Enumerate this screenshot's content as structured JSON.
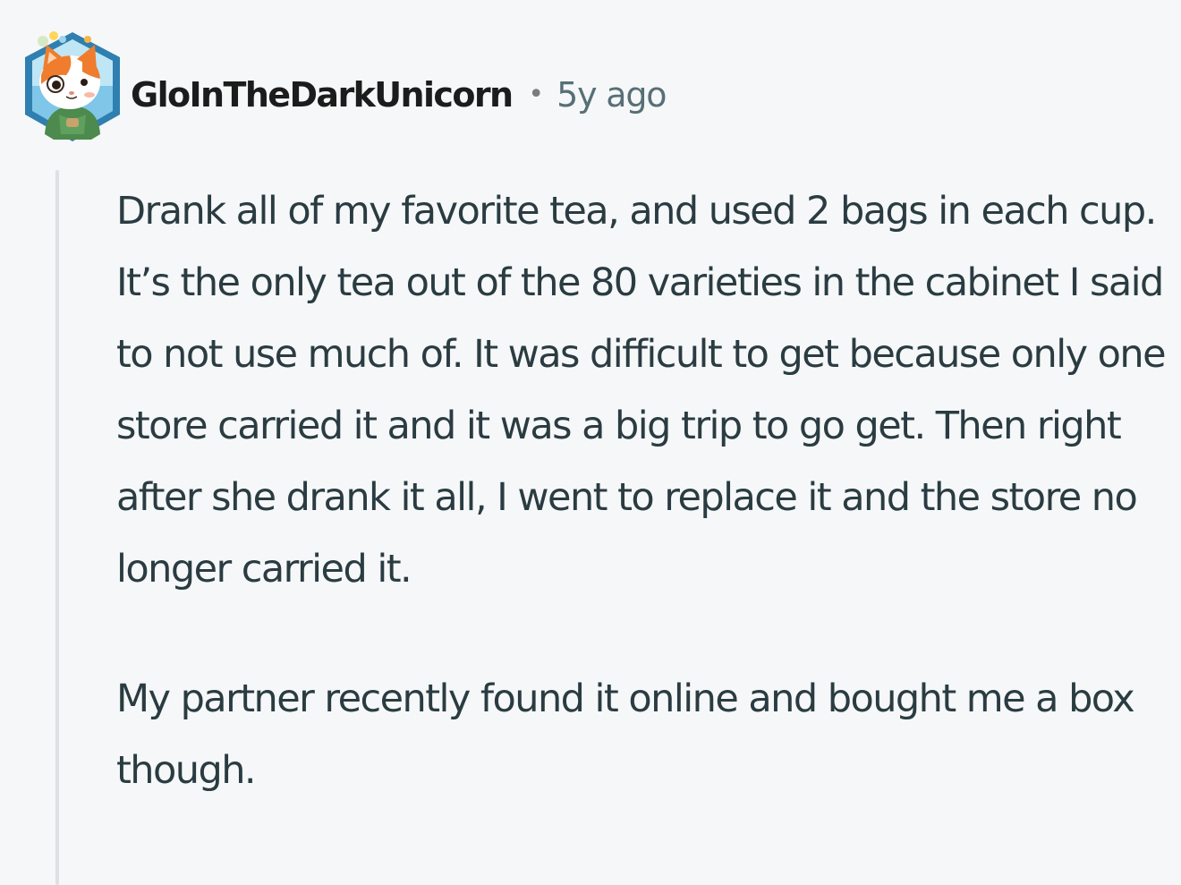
{
  "comment": {
    "author": "GloInTheDarkUnicorn",
    "separator": "•",
    "time_ago": "5y ago",
    "avatar_icon": "cat-hexagon-avatar-icon",
    "body": {
      "paragraph_1": "Drank all of my favorite tea, and used 2 bags in each cup. It’s the only tea out of the 80 varieties in the cabinet I said to not use much of. It was difficult to get because only one store carried it and it was a big trip to go get. Then right after she drank it all, I went to replace it and the store no longer carried it.",
      "paragraph_2": "My partner recently found it online and bought me a box though."
    }
  },
  "colors": {
    "background": "#f6f7f8",
    "username": "#1c1c1c",
    "meta": "#576f76",
    "body_text": "#2a3c42",
    "thread_line": "#dce1e5"
  }
}
